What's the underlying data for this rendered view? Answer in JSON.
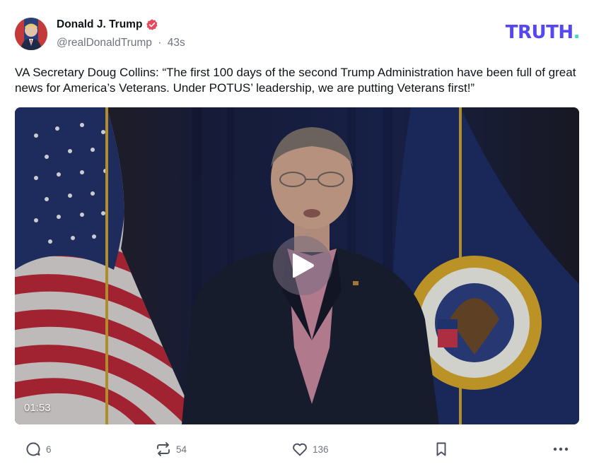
{
  "post": {
    "author": {
      "display_name": "Donald J. Trump",
      "handle": "@realDonaldTrump",
      "separator": "·",
      "time": "43s",
      "verified_icon": "verified-badge-icon",
      "verified_color": "#e5495b"
    },
    "brand": {
      "logo_text": "TRUTH",
      "logo_dot": ".",
      "logo_color": "#5448ee",
      "dot_color": "#3ddbc0"
    },
    "text": "VA Secretary Doug Collins: “The first 100 days of the second Trump Administration have been full of great news for America’s Veterans. Under POTUS’ leadership, we are putting Veterans first!”",
    "video": {
      "duration": "01:53",
      "play_icon": "play-icon"
    },
    "actions": {
      "replies": {
        "icon": "reply-bubble-icon",
        "count": "6"
      },
      "retruths": {
        "icon": "retruth-icon",
        "count": "54"
      },
      "likes": {
        "icon": "heart-icon",
        "count": "136"
      },
      "bookmark": {
        "icon": "bookmark-icon"
      },
      "more": {
        "icon": "more-dots-icon"
      }
    }
  }
}
